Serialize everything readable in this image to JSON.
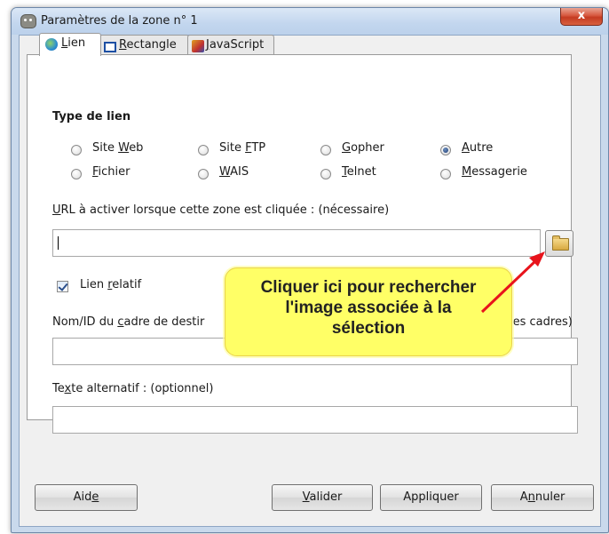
{
  "window": {
    "title": "Paramètres de la zone n° 1",
    "close_label": "x"
  },
  "tabs": [
    {
      "pre": "",
      "key": "L",
      "post": "ien",
      "icon": "globe-icon"
    },
    {
      "pre": "",
      "key": "R",
      "post": "ectangle",
      "icon": "rectangle-icon"
    },
    {
      "pre": "",
      "key": "J",
      "post": "avaScript",
      "icon": "javascript-icon"
    }
  ],
  "link_type": {
    "heading": "Type de lien",
    "options": [
      {
        "pre": "Site ",
        "key": "W",
        "post": "eb",
        "selected": false
      },
      {
        "pre": "Site ",
        "key": "F",
        "post": "TP",
        "selected": false
      },
      {
        "pre": "",
        "key": "G",
        "post": "opher",
        "selected": false
      },
      {
        "pre": "",
        "key": "A",
        "post": "utre",
        "selected": true
      },
      {
        "pre": "",
        "key": "F",
        "post": "ichier",
        "selected": false
      },
      {
        "pre": "",
        "key": "W",
        "post": "AIS",
        "selected": false
      },
      {
        "pre": "",
        "key": "T",
        "post": "elnet",
        "selected": false
      },
      {
        "pre": "",
        "key": "M",
        "post": "essagerie",
        "selected": false
      }
    ]
  },
  "url": {
    "label_key": "U",
    "label_rest": "RL à activer lorsque cette zone est cliquée : (nécessaire)",
    "value": ""
  },
  "relative": {
    "pre": "Lien ",
    "key": "r",
    "post": "elatif",
    "checked": true
  },
  "frame": {
    "label_pre": "Nom/ID du ",
    "label_key": "c",
    "label_mid": "adre de destir",
    "label_end": "les cadres)",
    "value": ""
  },
  "alt_text": {
    "label_pre": "Te",
    "label_key": "x",
    "label_post": "te alternatif : (optionnel)",
    "value": ""
  },
  "callout": {
    "line1": "Cliquer ici pour rechercher",
    "line2": "l'image associée à la",
    "line3": "sélection"
  },
  "buttons": {
    "help": {
      "pre": "Aid",
      "key": "e",
      "post": ""
    },
    "ok": {
      "pre": "",
      "key": "V",
      "post": "alider"
    },
    "apply": {
      "pre": "Appliquer",
      "key": "",
      "post": ""
    },
    "cancel": {
      "pre": "A",
      "key": "n",
      "post": "nuler"
    }
  },
  "colors": {
    "callout_bg": "#ffff66",
    "arrow": "#e8141c",
    "close_btn": "#c43b22"
  }
}
